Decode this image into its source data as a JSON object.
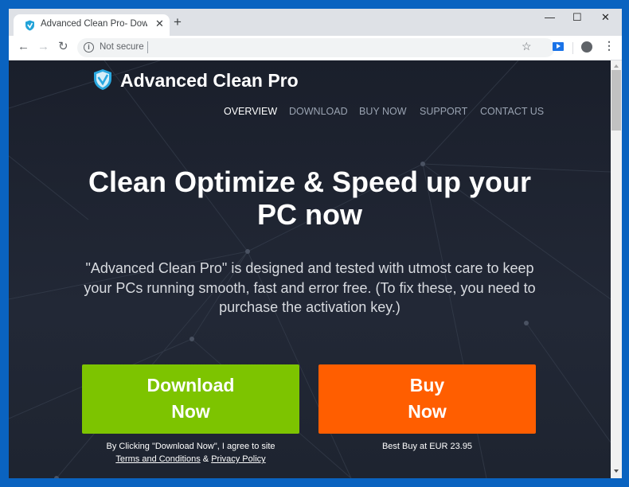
{
  "browser": {
    "tab_title": "Advanced Clean Pro- Download",
    "tab_close": "✕",
    "new_tab": "+",
    "window_controls": {
      "minimize": "—",
      "maximize": "☐",
      "close": "✕"
    },
    "nav": {
      "back": "←",
      "forward": "→",
      "reload": "↻"
    },
    "address": {
      "security_label": "Not secure",
      "info_glyph": "i",
      "value": ""
    },
    "bookmark_glyph": "☆",
    "menu_glyph": "⋮"
  },
  "site": {
    "brand": "Advanced Clean Pro",
    "nav": [
      {
        "label": "OVERVIEW",
        "active": true
      },
      {
        "label": "DOWNLOAD",
        "active": false
      },
      {
        "label": "BUY NOW",
        "active": false
      },
      {
        "label": "SUPPORT",
        "active": false
      },
      {
        "label": "CONTACT US",
        "active": false
      }
    ],
    "headline": "Clean Optimize & Speed up your PC now",
    "description": "\"Advanced Clean Pro\" is designed and tested with utmost care to keep your PCs running smooth, fast and error free. (To fix these, you need to purchase the activation key.)",
    "download_button": {
      "line1": "Download",
      "line2": "Now",
      "color": "#7dc400"
    },
    "buy_button": {
      "line1": "Buy",
      "line2": "Now",
      "color": "#ff5e00"
    },
    "download_note": "By Clicking \"Download Now\", I agree to site",
    "terms_link": "Terms and Conditions",
    "ampersand": "&",
    "privacy_link": "Privacy Policy",
    "price_note": "Best Buy at EUR 23.95"
  }
}
